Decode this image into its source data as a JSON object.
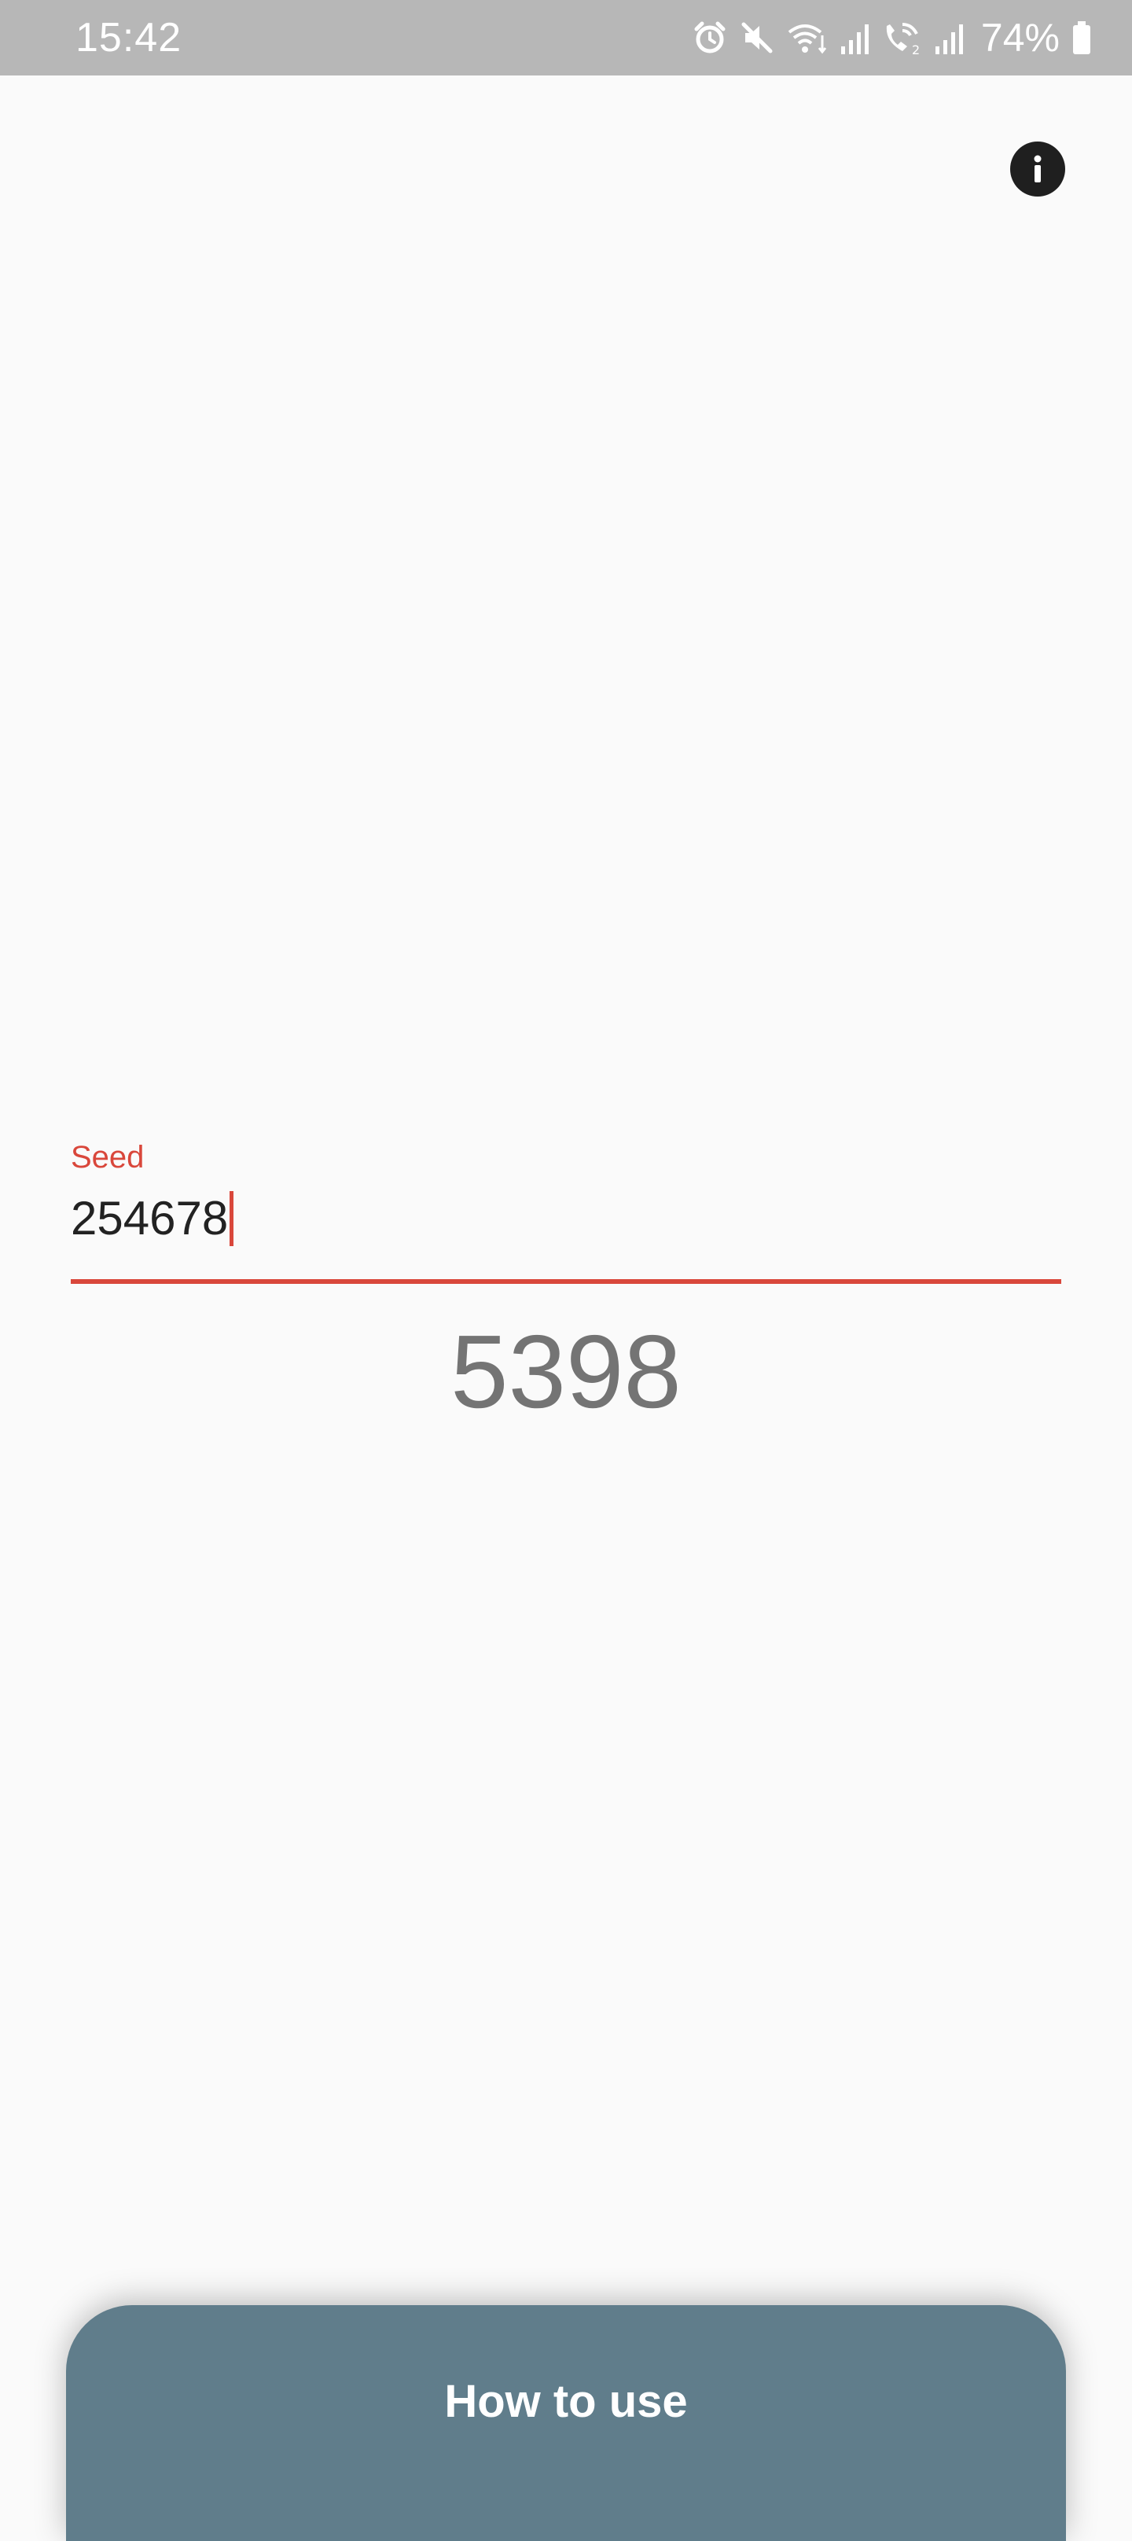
{
  "status_bar": {
    "time": "15:42",
    "battery": "74%",
    "icons": [
      "alarm-icon",
      "mute-icon",
      "wifi-icon",
      "signal-icon",
      "wifi-call-icon",
      "signal-icon",
      "battery-icon"
    ]
  },
  "main": {
    "info_icon": "info-icon",
    "seed": {
      "label": "Seed",
      "value": "254678"
    },
    "result": "5398"
  },
  "bottom_panel": {
    "label": "How to use"
  },
  "colors": {
    "accent": "#d9473b",
    "panel": "#607d8b",
    "status_bar": "#b7b7b7",
    "background": "#fafafa",
    "result_text": "#747474"
  }
}
